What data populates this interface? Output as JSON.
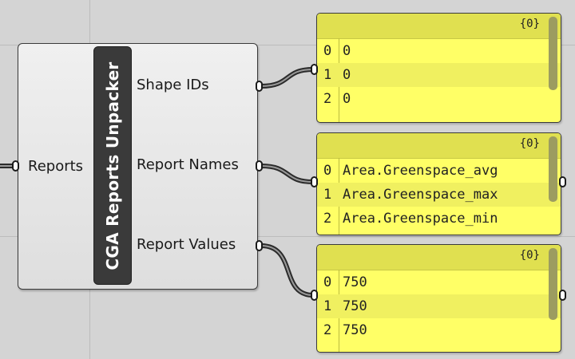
{
  "component": {
    "title": "CGA Reports Unpacker",
    "inputs": [
      {
        "label": "Reports"
      }
    ],
    "outputs": [
      {
        "label": "Shape IDs"
      },
      {
        "label": "Report Names"
      },
      {
        "label": "Report Values"
      }
    ]
  },
  "panels": [
    {
      "path": "{0}",
      "rows": [
        {
          "index": "0",
          "value": "0"
        },
        {
          "index": "1",
          "value": "0"
        },
        {
          "index": "2",
          "value": "0"
        }
      ]
    },
    {
      "path": "{0}",
      "rows": [
        {
          "index": "0",
          "value": "Area.Greenspace_avg"
        },
        {
          "index": "1",
          "value": "Area.Greenspace_max"
        },
        {
          "index": "2",
          "value": "Area.Greenspace_min"
        }
      ]
    },
    {
      "path": "{0}",
      "rows": [
        {
          "index": "0",
          "value": "750"
        },
        {
          "index": "1",
          "value": "750"
        },
        {
          "index": "2",
          "value": "750"
        }
      ]
    }
  ]
}
